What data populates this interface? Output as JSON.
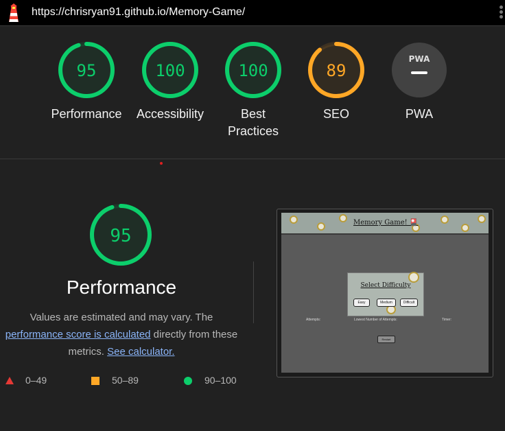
{
  "browser": {
    "url": "https://chrisryan91.github.io/Memory-Game/",
    "logo_icon": "lighthouse-icon",
    "menu_icon": "kebab-menu-icon"
  },
  "categories": [
    {
      "label": "Performance",
      "score": "95",
      "fraction": 0.95,
      "rating": "pass"
    },
    {
      "label": "Accessibility",
      "score": "100",
      "fraction": 1.0,
      "rating": "pass"
    },
    {
      "label": "Best Practices",
      "score": "100",
      "fraction": 1.0,
      "rating": "pass"
    },
    {
      "label": "SEO",
      "score": "89",
      "fraction": 0.89,
      "rating": "average"
    },
    {
      "label": "PWA",
      "score": "",
      "fraction": 0,
      "rating": "na",
      "badge": "PWA"
    }
  ],
  "colors": {
    "pass": "#0cce6b",
    "average": "#ffa726",
    "fail": "#e53935",
    "na": "#424242"
  },
  "performance": {
    "score": "95",
    "fraction": 0.95,
    "title": "Performance",
    "desc_part1": "Values are estimated and may vary. The ",
    "desc_link1": "performance score is calculated",
    "desc_part2": " directly from these metrics. ",
    "desc_link2": "See calculator."
  },
  "legend": [
    {
      "shape": "triangle",
      "label": "0–49"
    },
    {
      "shape": "square",
      "label": "50–89"
    },
    {
      "shape": "circle",
      "label": "90–100"
    }
  ],
  "screenshot": {
    "title": "Memory Game! 🎴",
    "modal_title": "Select Difficulty",
    "buttons": [
      "Easy",
      "Medium",
      "Difficult"
    ],
    "stats": [
      "Attempts:",
      "Lowest Number of Attempts:",
      "Timer:"
    ],
    "reset_label": "Restart"
  }
}
